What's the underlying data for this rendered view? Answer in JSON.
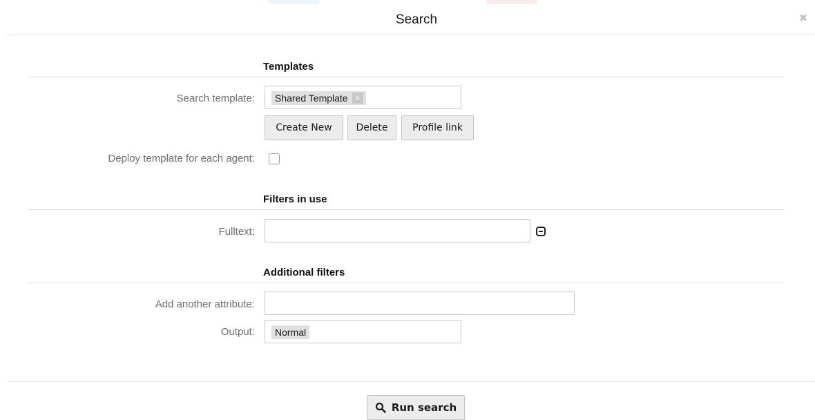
{
  "dialog": {
    "title": "Search",
    "close_icon": "close-icon"
  },
  "templates": {
    "section_title": "Templates",
    "search_template_label": "Search template:",
    "search_template_value": "Shared Template",
    "search_template_remove": "x",
    "buttons": {
      "create_new": "Create New",
      "delete": "Delete",
      "profile_link": "Profile link"
    },
    "deploy_label": "Deploy template for each agent:",
    "deploy_checked": false
  },
  "filters_in_use": {
    "section_title": "Filters in use",
    "fulltext_label": "Fulltext:",
    "fulltext_value": "",
    "remove_icon": "remove-filter-icon"
  },
  "additional_filters": {
    "section_title": "Additional filters",
    "add_attribute_label": "Add another attribute:",
    "add_attribute_value": "",
    "output_label": "Output:",
    "output_value": "Normal"
  },
  "footer": {
    "run_search_label": "Run search",
    "run_search_icon": "search-icon"
  }
}
